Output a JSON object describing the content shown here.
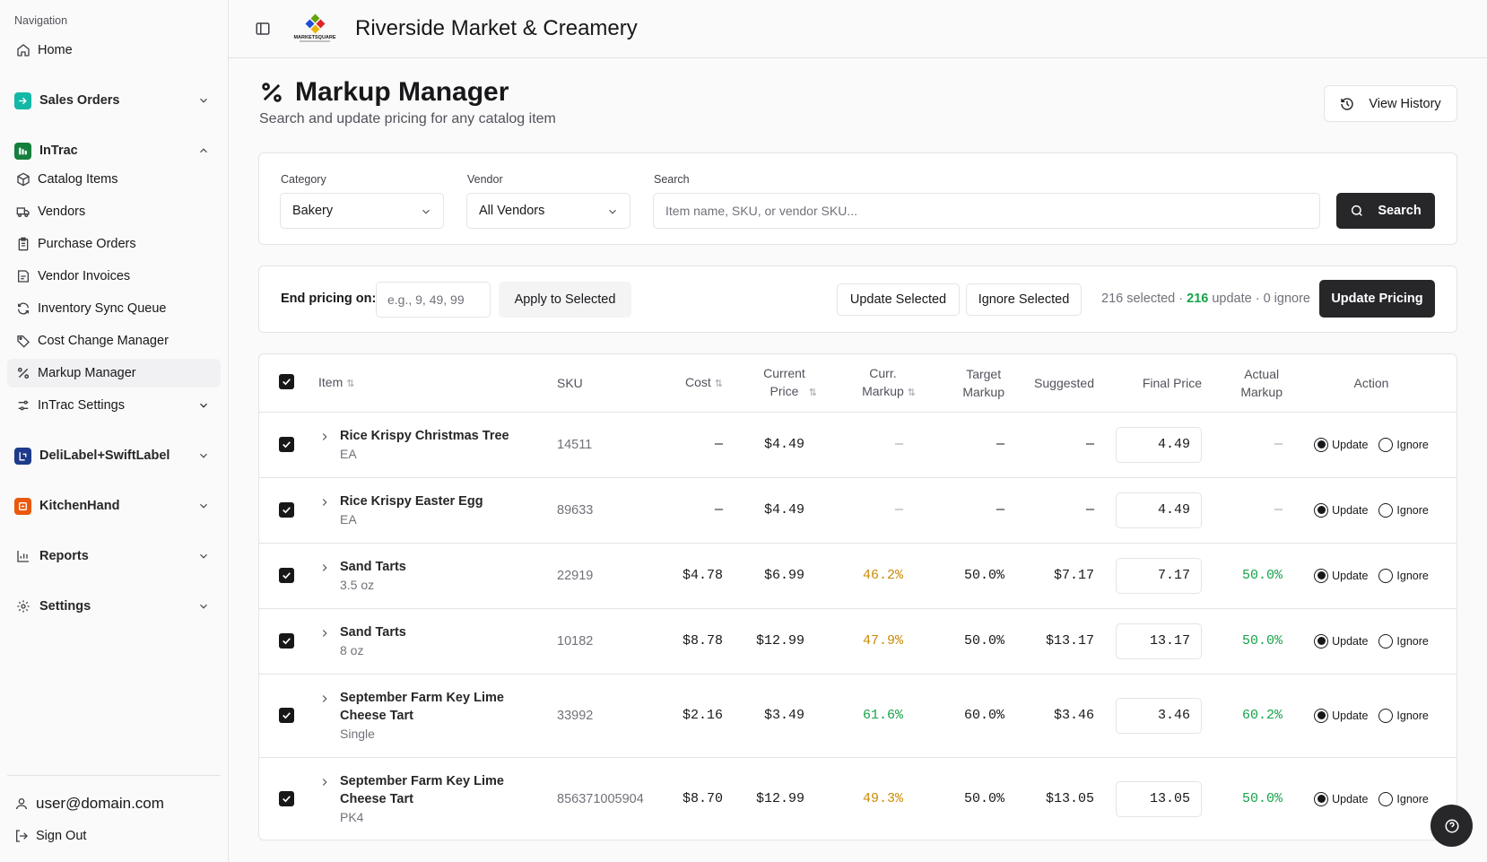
{
  "sidebar": {
    "heading": "Navigation",
    "home": "Home",
    "sales_orders": "Sales Orders",
    "intrac": "InTrac",
    "intrac_items": [
      "Catalog Items",
      "Vendors",
      "Purchase Orders",
      "Vendor Invoices",
      "Inventory Sync Queue",
      "Cost Change Manager",
      "Markup Manager",
      "InTrac Settings"
    ],
    "deli": "DeliLabel+SwiftLabel",
    "kitchen": "KitchenHand",
    "reports": "Reports",
    "settings": "Settings",
    "user": "user@domain.com",
    "sign_out": "Sign Out"
  },
  "header": {
    "store_name": "Riverside Market & Creamery",
    "logo_text": "MARKETSQUARE"
  },
  "page": {
    "title": "Markup Manager",
    "subtitle": "Search and update pricing for any catalog item",
    "history_label": "View History"
  },
  "filters": {
    "category_label": "Category",
    "category_value": "Bakery",
    "vendor_label": "Vendor",
    "vendor_value": "All Vendors",
    "search_label": "Search",
    "search_placeholder": "Item name, SKU, or vendor SKU...",
    "search_button": "Search"
  },
  "pricing": {
    "end_label": "End pricing on:",
    "end_placeholder": "e.g., 9, 49, 99",
    "apply_label": "Apply to Selected",
    "update_selected": "Update Selected",
    "ignore_selected": "Ignore Selected",
    "status_selected": "216 selected · ",
    "status_update_count": "216",
    "status_update_suffix": " update · 0 ignore",
    "update_pricing": "Update Pricing"
  },
  "table": {
    "headers": {
      "item": "Item",
      "sku": "SKU",
      "cost": "Cost",
      "current_price_1": "Current",
      "current_price_2": "Price",
      "curr_markup_1": "Curr.",
      "curr_markup_2": "Markup",
      "target_markup_1": "Target",
      "target_markup_2": "Markup",
      "suggested": "Suggested",
      "final_price": "Final Price",
      "actual_markup_1": "Actual",
      "actual_markup_2": "Markup",
      "action": "Action"
    },
    "rows": [
      {
        "name": "Rice Krispy Christmas Tree",
        "unit": "EA",
        "sku": "14511",
        "cost": "—",
        "current": "$4.49",
        "curr_markup": "—",
        "target": "—",
        "suggested": "—",
        "final": "4.49",
        "actual": "—",
        "update": "Update",
        "ignore": "Ignore"
      },
      {
        "name": "Rice Krispy Easter Egg",
        "unit": "EA",
        "sku": "89633",
        "cost": "—",
        "current": "$4.49",
        "curr_markup": "—",
        "target": "—",
        "suggested": "—",
        "final": "4.49",
        "actual": "—",
        "update": "Update",
        "ignore": "Ignore"
      },
      {
        "name": "Sand Tarts",
        "unit": "3.5 oz",
        "sku": "22919",
        "cost": "$4.78",
        "current": "$6.99",
        "curr_markup": "46.2%",
        "target": "50.0%",
        "suggested": "$7.17",
        "final": "7.17",
        "actual": "50.0%",
        "update": "Update",
        "ignore": "Ignore"
      },
      {
        "name": "Sand Tarts",
        "unit": "8 oz",
        "sku": "10182",
        "cost": "$8.78",
        "current": "$12.99",
        "curr_markup": "47.9%",
        "target": "50.0%",
        "suggested": "$13.17",
        "final": "13.17",
        "actual": "50.0%",
        "update": "Update",
        "ignore": "Ignore"
      },
      {
        "name": "September Farm Key Lime Cheese Tart",
        "unit": "Single",
        "sku": "33992",
        "cost": "$2.16",
        "current": "$3.49",
        "curr_markup": "61.6%",
        "target": "60.0%",
        "suggested": "$3.46",
        "final": "3.46",
        "actual": "60.2%",
        "update": "Update",
        "ignore": "Ignore"
      },
      {
        "name": "September Farm Key Lime Cheese Tart",
        "unit": "PK4",
        "sku": "856371005904",
        "cost": "$8.70",
        "current": "$12.99",
        "curr_markup": "49.3%",
        "target": "50.0%",
        "suggested": "$13.05",
        "final": "13.05",
        "actual": "50.0%",
        "update": "Update",
        "ignore": "Ignore"
      }
    ]
  },
  "colors": {
    "primary_dark": "#27272a",
    "amber": "#ca8a04",
    "green": "#16a34a",
    "sales_icon": "#14b8a6",
    "intrac_icon": "#15803d",
    "deli_icon": "#1e3a8a",
    "kitchen_icon": "#ea580c"
  }
}
